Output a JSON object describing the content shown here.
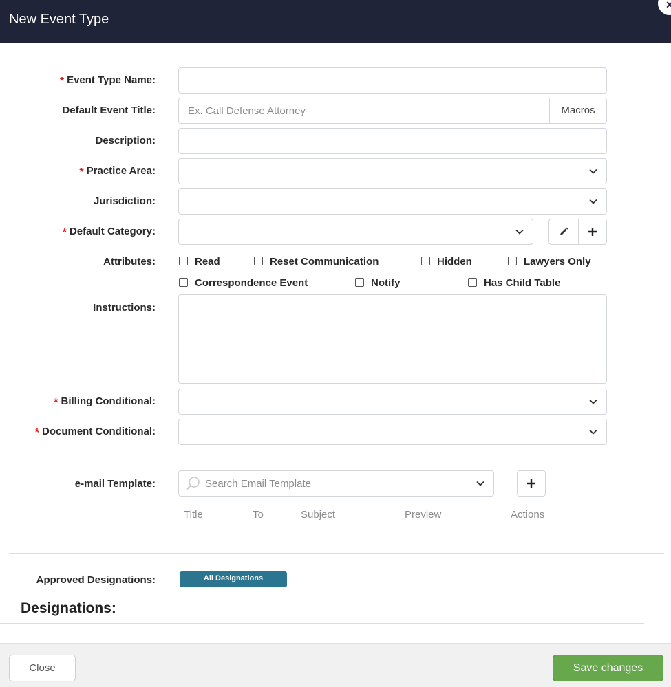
{
  "header": {
    "title": "New Event Type",
    "close_glyph": "×"
  },
  "form": {
    "required_marker": "*",
    "event_type_name": {
      "label": "Event Type Name:",
      "value": ""
    },
    "default_event_title": {
      "label": "Default Event Title:",
      "placeholder": "Ex. Call Defense Attorney",
      "macros_label": "Macros"
    },
    "description": {
      "label": "Description:",
      "value": ""
    },
    "practice_area": {
      "label": "Practice Area:",
      "value": ""
    },
    "jurisdiction": {
      "label": "Jurisdiction:",
      "value": ""
    },
    "default_category": {
      "label": "Default Category:",
      "value": "",
      "edit_icon": "pencil-icon",
      "add_icon": "plus-icon"
    },
    "attributes": {
      "label": "Attributes:",
      "options": [
        "Read",
        "Reset Communication",
        "Hidden",
        "Lawyers Only",
        "Correspondence Event",
        "Notify",
        "Has Child Table"
      ]
    },
    "instructions": {
      "label": "Instructions:",
      "value": ""
    },
    "billing_conditional": {
      "label": "Billing Conditional:",
      "value": ""
    },
    "document_conditional": {
      "label": "Document Conditional:",
      "value": ""
    }
  },
  "email_template": {
    "label": "e-mail Template:",
    "placeholder": "Search Email Template",
    "columns": [
      "Title",
      "To",
      "Subject",
      "Preview",
      "Actions"
    ]
  },
  "designations": {
    "approved_label": "Approved Designations:",
    "badge": "All Designations",
    "section_title": "Designations:"
  },
  "footer": {
    "close_label": "Close",
    "save_label": "Save changes"
  },
  "colors": {
    "header_bg": "#1f2438",
    "required": "#e0201e",
    "badge_bg": "#2b7590",
    "save_bg": "#67a84d"
  }
}
